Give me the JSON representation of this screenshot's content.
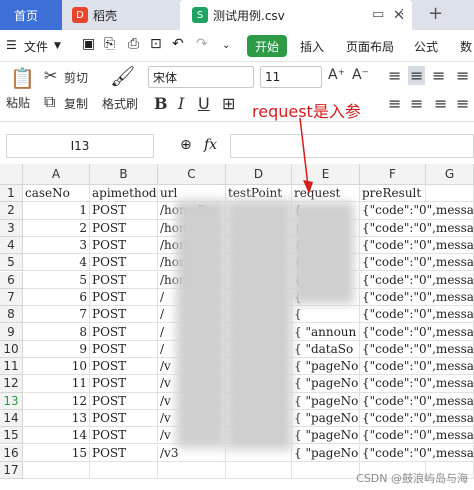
{
  "tabs": {
    "home": "首页",
    "docer": "稻壳",
    "docer_logo": "D",
    "file": "测试用例.csv",
    "file_logo": "S"
  },
  "menu": {
    "file": "文件",
    "start": "开始",
    "insert": "插入",
    "layout": "页面布局",
    "formula": "公式",
    "data": "数"
  },
  "toolbar": {
    "paste": "粘贴",
    "cut": "剪切",
    "copy": "复制",
    "format_painter": "格式刷",
    "font": "宋体",
    "font_size": "11"
  },
  "formula_bar": {
    "cell_ref": "I13",
    "fx": "fx"
  },
  "grid": {
    "columns": [
      "A",
      "B",
      "C",
      "D",
      "E",
      "F",
      "G"
    ],
    "headers": [
      "caseNo",
      "apimethod",
      "url",
      "testPoint",
      "request",
      "preResult"
    ],
    "rows": [
      {
        "n": "1",
        "case": "1",
        "method": "POST",
        "url": "/homePa",
        "req": "{",
        "pre": "{\"code\":\"0\",messa"
      },
      {
        "n": "2",
        "case": "2",
        "method": "POST",
        "url": "/homePa",
        "req": "{",
        "pre": "{\"code\":\"0\",messa"
      },
      {
        "n": "3",
        "case": "3",
        "method": "POST",
        "url": "/homeP",
        "req": "{",
        "pre": "{\"code\":\"0\",messa"
      },
      {
        "n": "4",
        "case": "4",
        "method": "POST",
        "url": "/homePa",
        "req": "{",
        "pre": "{\"code\":\"0\",messa"
      },
      {
        "n": "5",
        "case": "5",
        "method": "POST",
        "url": "/homePa",
        "req": "{",
        "pre": "{\"code\":\"0\",messa"
      },
      {
        "n": "6",
        "case": "6",
        "method": "POST",
        "url": "/",
        "req": "{",
        "pre": "{\"code\":\"0\",messa"
      },
      {
        "n": "7",
        "case": "7",
        "method": "POST",
        "url": "/",
        "req": "{",
        "pre": "{\"code\":\"0\",messa"
      },
      {
        "n": "8",
        "case": "8",
        "method": "POST",
        "url": "/",
        "req": "{ \"announ",
        "pre": "{\"code\":\"0\",messa"
      },
      {
        "n": "9",
        "case": "9",
        "method": "POST",
        "url": "/",
        "req": "{ \"dataSo",
        "pre": "{\"code\":\"0\",messa"
      },
      {
        "n": "10",
        "case": "10",
        "method": "POST",
        "url": "/v",
        "req": "{ \"pageNo",
        "pre": "{\"code\":\"0\",messa"
      },
      {
        "n": "11",
        "case": "11",
        "method": "POST",
        "url": "/v",
        "req": "{ \"pageNo",
        "pre": "{\"code\":\"0\",messa"
      },
      {
        "n": "12",
        "case": "12",
        "method": "POST",
        "url": "/v",
        "req": "{ \"pageNo",
        "pre": "{\"code\":\"0\",messa"
      },
      {
        "n": "13",
        "case": "13",
        "method": "POST",
        "url": "/v",
        "req": "{ \"pageNo",
        "pre": "{\"code\":\"0\",messa"
      },
      {
        "n": "14",
        "case": "14",
        "method": "POST",
        "url": "/v",
        "req": "{ \"pageNo",
        "pre": "{\"code\":\"0\",messa"
      },
      {
        "n": "15",
        "case": "15",
        "method": "POST",
        "url": "/v3",
        "req": "{ \"pageNo",
        "pre": "{\"code\":\"0\",messa"
      }
    ],
    "row_numbers": [
      "1",
      "2",
      "3",
      "4",
      "5",
      "6",
      "7",
      "8",
      "9",
      "10",
      "11",
      "12",
      "13",
      "14",
      "15",
      "16",
      "17"
    ],
    "active_row": "13"
  },
  "annotation": "request是入参",
  "watermark": "CSDN @鼓浪屿岛与海",
  "colors": {
    "annotation": "#d61d1d",
    "start_button": "#2d9b46",
    "home_tab": "#3d6fd6",
    "active_row_header": "#2d9b46"
  }
}
